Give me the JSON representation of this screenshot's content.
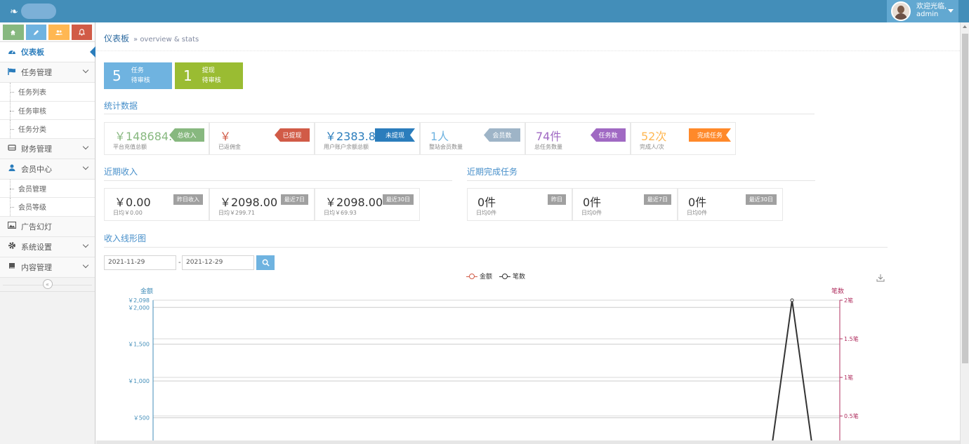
{
  "navbar": {
    "welcome": "欢迎光临,",
    "username": "admin"
  },
  "shortcuts": [
    {
      "icon": "home-icon",
      "color": "#87b87f"
    },
    {
      "icon": "pencil-icon",
      "color": "#6fb3e0"
    },
    {
      "icon": "users-icon",
      "color": "#ffb752"
    },
    {
      "icon": "bell-icon",
      "color": "#d15b47"
    }
  ],
  "sidebar": {
    "items": [
      {
        "label": "仪表板",
        "icon": "dashboard-icon",
        "active": true
      },
      {
        "label": "任务管理",
        "icon": "flag-icon",
        "children": [
          "任务列表",
          "任务审核",
          "任务分类"
        ]
      },
      {
        "label": "财务管理",
        "icon": "hdd-icon"
      },
      {
        "label": "会员中心",
        "icon": "user-icon",
        "children": [
          "会员管理",
          "会员等级"
        ]
      },
      {
        "label": "广告幻灯",
        "icon": "picture-icon"
      },
      {
        "label": "系统设置",
        "icon": "cog-icon"
      },
      {
        "label": "内容管理",
        "icon": "book-icon"
      }
    ],
    "collapse": "«"
  },
  "breadcrumb": {
    "title": "仪表板",
    "subtitle": "» overview & stats"
  },
  "infoboxes": [
    {
      "num": "5",
      "line1": "任务",
      "line2": "待审核",
      "color": "#6fb3e0"
    },
    {
      "num": "1",
      "line1": "提现",
      "line2": "待审核",
      "color": "#9abc32"
    }
  ],
  "stats_title": "统计数据",
  "stats": [
    {
      "value": "￥148684.0",
      "sub": "平台充值总额",
      "badge": "总收入",
      "value_color": "#87b87f",
      "badge_color": "#87b87f"
    },
    {
      "value": "￥",
      "sub": "已返佣金",
      "badge": "已提现",
      "value_color": "#d15b47",
      "badge_color": "#d15b47"
    },
    {
      "value": "￥2383.87",
      "sub": "用户账户余额总额",
      "badge": "未提现",
      "value_color": "#2b7dbc",
      "badge_color": "#2b7dbc"
    },
    {
      "value": "1人",
      "sub": "整站会员数量",
      "badge": "会员数",
      "value_color": "#6fb3e0",
      "badge_color": "#9eb4c7"
    },
    {
      "value": "74件",
      "sub": "总任务数量",
      "badge": "任务数",
      "value_color": "#a069c3",
      "badge_color": "#a069c3"
    },
    {
      "value": "52次",
      "sub": "完成人/次",
      "badge": "完成任务",
      "value_color": "#ffb752",
      "badge_color": "#ff892a"
    }
  ],
  "income_title": "近期收入",
  "income": [
    {
      "value": "￥0.00",
      "sub": "日均￥0.00",
      "badge": "昨日收入"
    },
    {
      "value": "￥2098.00",
      "sub": "日均￥299.71",
      "badge": "最近7日"
    },
    {
      "value": "￥2098.00",
      "sub": "日均￥69.93",
      "badge": "最近30日"
    }
  ],
  "tasks_title": "近期完成任务",
  "tasks": [
    {
      "value": "0件",
      "sub": "日均0件",
      "badge": "昨日"
    },
    {
      "value": "0件",
      "sub": "日均0件",
      "badge": "最近7日"
    },
    {
      "value": "0件",
      "sub": "日均0件",
      "badge": "最近30日"
    }
  ],
  "chart_title": "收入线形图",
  "date_from": "2021-11-29",
  "date_sep": "-",
  "date_to": "2021-12-29",
  "chart_data": {
    "type": "line",
    "legend": [
      "金额",
      "笔数"
    ],
    "series": [
      {
        "name": "金额",
        "color": "#d15b47",
        "axis": "left"
      },
      {
        "name": "笔数",
        "color": "#333333",
        "axis": "right",
        "peak_value": 2
      }
    ],
    "ylabel_left": "金额",
    "ylabel_right": "笔数",
    "yticks_left": [
      "￥2,098",
      "￥2,000",
      "￥1,500",
      "￥1,000",
      "￥500"
    ],
    "yticks_left_values": [
      2098,
      2000,
      1500,
      1000,
      500
    ],
    "yticks_right": [
      "2笔",
      "1.5笔",
      "1笔",
      "0.5笔"
    ],
    "yticks_right_values": [
      2,
      1.5,
      1,
      0.5
    ],
    "left_color": "#438eb9",
    "right_color": "#b03060"
  }
}
